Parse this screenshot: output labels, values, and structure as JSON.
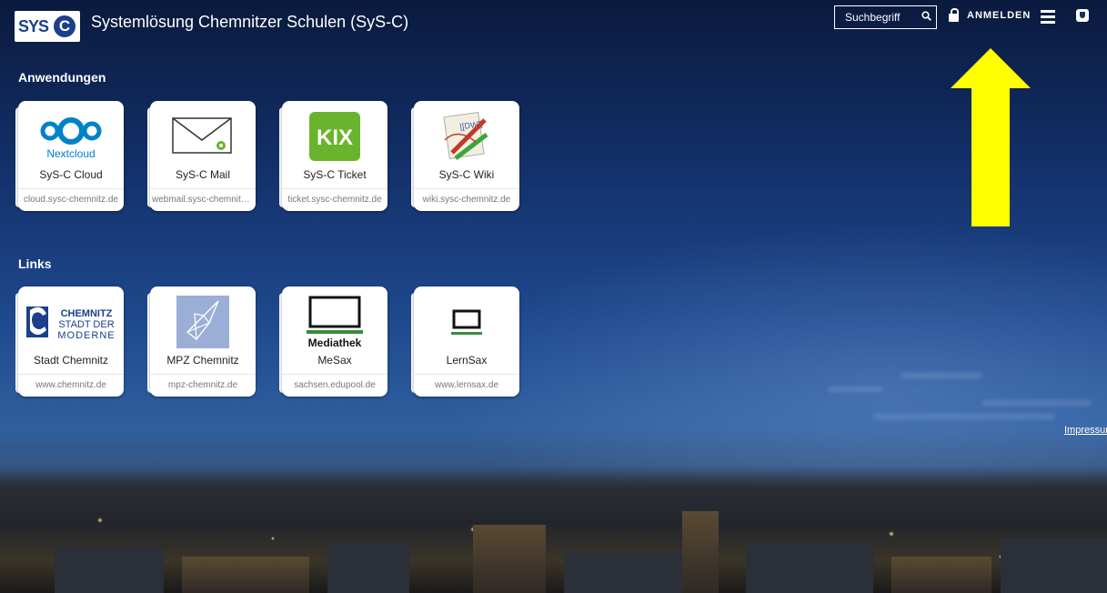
{
  "header": {
    "logo_text": "SYS",
    "logo_c": "C",
    "title": "Systemlösung Chemnitzer Schulen (SyS-C)",
    "search_placeholder": "Suchbegriff",
    "search_icon": "search-icon",
    "login_label": "ANMELDEN",
    "login_icon": "lock-icon",
    "menu_icon": "hamburger-menu-icon",
    "extra_icon": "u-badge-icon"
  },
  "sections": {
    "apps_title": "Anwendungen",
    "links_title": "Links"
  },
  "apps": [
    {
      "name": "SyS-C Cloud",
      "url": "cloud.sysc-chemnitz.de",
      "logo_caption": "Nextcloud",
      "icon": "nextcloud-logo"
    },
    {
      "name": "SyS-C Mail",
      "url": "webmail.sysc-chemnitz.de",
      "icon": "mail-envelope-icon"
    },
    {
      "name": "SyS-C Ticket",
      "url": "ticket.sysc-chemnitz.de",
      "logo_caption": "KIX",
      "icon": "kix-logo"
    },
    {
      "name": "SyS-C Wiki",
      "url": "wiki.sysc-chemnitz.de",
      "logo_caption": "[[DW]]",
      "icon": "dokuwiki-logo"
    }
  ],
  "links": [
    {
      "name": "Stadt Chemnitz",
      "url": "www.chemnitz.de",
      "logo_lines": [
        "CHEMNITZ",
        "STADT DER",
        "MODERNE"
      ],
      "icon": "chemnitz-logo"
    },
    {
      "name": "MPZ Chemnitz",
      "url": "mpz-chemnitz.de",
      "icon": "origami-bird-logo"
    },
    {
      "name": "MeSax",
      "url": "sachsen.edupool.de",
      "logo_caption": "Mediathek",
      "icon": "mediathek-monitor-logo"
    },
    {
      "name": "LernSax",
      "url": "www.lernsax.de",
      "icon": "lernsax-monitor-logo"
    }
  ],
  "footer": {
    "impressum": "Impressum"
  },
  "colors": {
    "brand_blue": "#1b3f8c",
    "nextcloud_blue": "#0082c9",
    "kix_green": "#6ab42d",
    "arrow_yellow": "#ffff00",
    "link_green": "#3a8a3a"
  }
}
